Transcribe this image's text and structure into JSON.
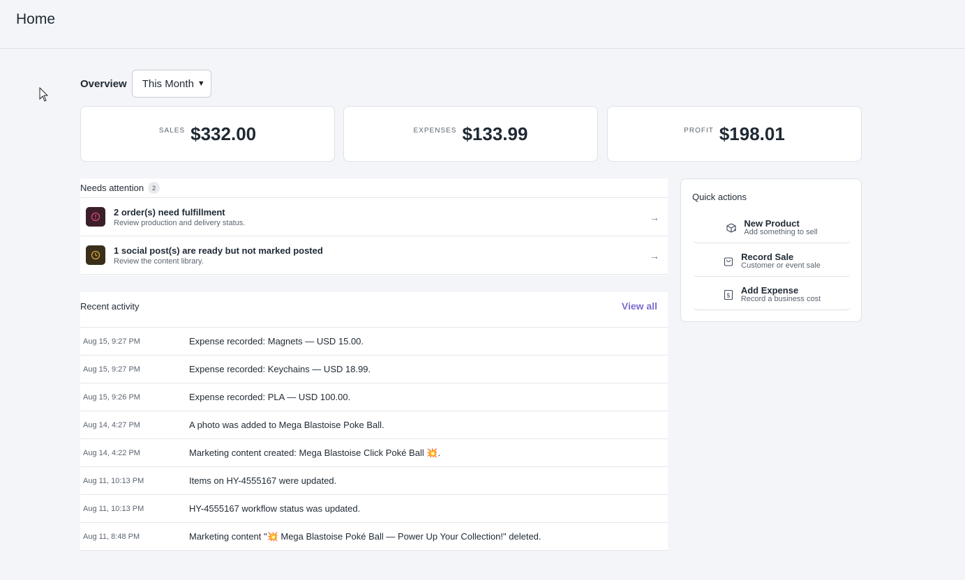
{
  "header": {
    "title": "Home"
  },
  "overview": {
    "label": "Overview",
    "period": "This Month"
  },
  "stats": [
    {
      "label": "SALES",
      "value": "$332.00"
    },
    {
      "label": "EXPENSES",
      "value": "$133.99"
    },
    {
      "label": "PROFIT",
      "value": "$198.01"
    }
  ],
  "attention": {
    "title": "Needs attention",
    "count": "2",
    "items": [
      {
        "title": "2 order(s) need fulfillment",
        "subtitle": "Review production and delivery status.",
        "icon": "alert-circle-icon",
        "color": "#e0457b"
      },
      {
        "title": "1 social post(s) are ready but not marked posted",
        "subtitle": "Review the content library.",
        "icon": "clock-icon",
        "color": "#d9a441"
      }
    ]
  },
  "quick_actions": {
    "title": "Quick actions",
    "items": [
      {
        "title": "New Product",
        "subtitle": "Add something to sell",
        "icon": "package-plus-icon"
      },
      {
        "title": "Record Sale",
        "subtitle": "Customer or event sale",
        "icon": "shopping-bag-icon"
      },
      {
        "title": "Add Expense",
        "subtitle": "Record a business cost",
        "icon": "dollar-receipt-icon"
      }
    ]
  },
  "recent": {
    "title": "Recent activity",
    "view_all": "View all",
    "rows": [
      {
        "time": "Aug 15, 9:27 PM",
        "text": "Expense recorded: Magnets — USD 15.00."
      },
      {
        "time": "Aug 15, 9:27 PM",
        "text": "Expense recorded: Keychains — USD 18.99."
      },
      {
        "time": "Aug 15, 9:26 PM",
        "text": "Expense recorded: PLA — USD 100.00."
      },
      {
        "time": "Aug 14, 4:27 PM",
        "text": "A photo was added to Mega Blastoise Poke Ball."
      },
      {
        "time": "Aug 14, 4:22 PM",
        "text": "Marketing content created: Mega Blastoise Click Poké Ball 💥."
      },
      {
        "time": "Aug 11, 10:13 PM",
        "text": "Items on HY-4555167 were updated."
      },
      {
        "time": "Aug 11, 10:13 PM",
        "text": "HY-4555167 workflow status was updated."
      },
      {
        "time": "Aug 11, 8:48 PM",
        "text": "Marketing content \"💥 Mega Blastoise Poké Ball — Power Up Your Collection!\" deleted."
      }
    ]
  }
}
